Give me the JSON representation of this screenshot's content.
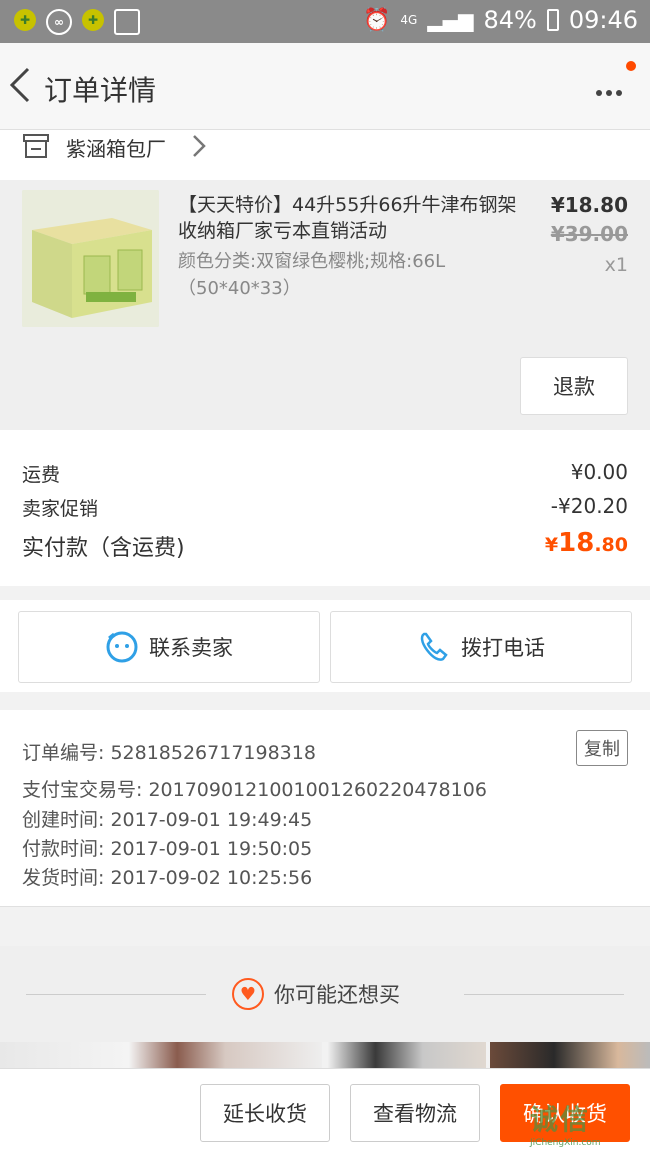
{
  "status_bar": {
    "battery": "84%",
    "time": "09:46",
    "network": "4G"
  },
  "header": {
    "title": "订单详情"
  },
  "shop": {
    "name": "紫涵箱包厂"
  },
  "item": {
    "title": "【天天特价】44升55升66升牛津布钢架收纳箱厂家亏本直销活动",
    "spec": "颜色分类:双窗绿色樱桃;规格:66L（50*40*33）",
    "price": "¥18.80",
    "original_price": "¥39.00",
    "quantity": "x1",
    "refund_label": "退款"
  },
  "fees": {
    "shipping_label": "运费",
    "shipping_value": "¥0.00",
    "promo_label": "卖家促销",
    "promo_value": "-¥20.20",
    "total_label": "实付款（含运费)",
    "total_currency": "¥",
    "total_int": "18",
    "total_dec": ".80"
  },
  "contact": {
    "seller": "联系卖家",
    "call": "拨打电话"
  },
  "order_info": {
    "order_no": "订单编号: 52818526717198318",
    "copy_label": "复制",
    "alipay_no": "支付宝交易号: 2017090121001001260220478106",
    "created": "创建时间: 2017-09-01 19:49:45",
    "paid": "付款时间: 2017-09-01 19:50:05",
    "shipped": "发货时间: 2017-09-02 10:25:56"
  },
  "recommend": {
    "title": "你可能还想买"
  },
  "bottom": {
    "extend": "延长收货",
    "logistics": "查看物流",
    "confirm": "确认收货"
  },
  "watermark": {
    "main": "诚信",
    "sub": "JiChengXin.com"
  }
}
